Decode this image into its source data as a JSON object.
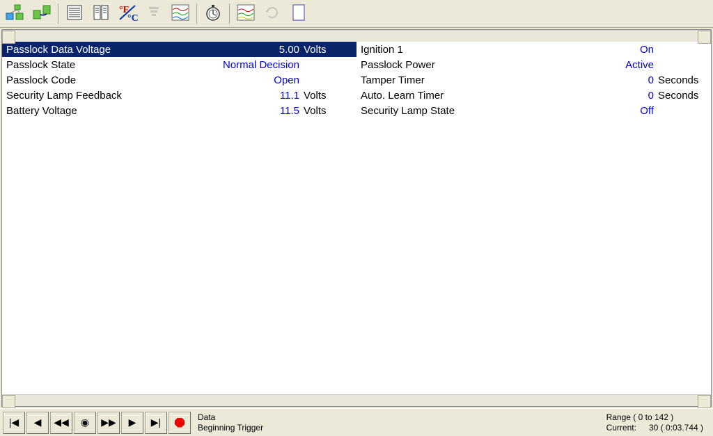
{
  "left": [
    {
      "name": "Passlock Data Voltage",
      "value": "5.00",
      "unit": "Volts",
      "selected": true
    },
    {
      "name": "Passlock State",
      "value": "Normal Decision",
      "unit": ""
    },
    {
      "name": "Passlock Code",
      "value": "Open",
      "unit": ""
    },
    {
      "name": "Security Lamp Feedback",
      "value": "11.1",
      "unit": "Volts"
    },
    {
      "name": "Battery Voltage",
      "value": "11.5",
      "unit": "Volts"
    }
  ],
  "right": [
    {
      "name": "Ignition 1",
      "value": "On",
      "unit": ""
    },
    {
      "name": "Passlock Power",
      "value": "Active",
      "unit": ""
    },
    {
      "name": "Tamper Timer",
      "value": "0",
      "unit": "Seconds"
    },
    {
      "name": "Auto. Learn Timer",
      "value": "0",
      "unit": "Seconds"
    },
    {
      "name": "Security Lamp State",
      "value": "Off",
      "unit": ""
    }
  ],
  "status": {
    "line1": "Data",
    "line2": "Beginning Trigger"
  },
  "range": {
    "label": "Range ( 0 to 142 )",
    "current_label": "Current:",
    "current_value": "30 ( 0:03.744 )"
  }
}
